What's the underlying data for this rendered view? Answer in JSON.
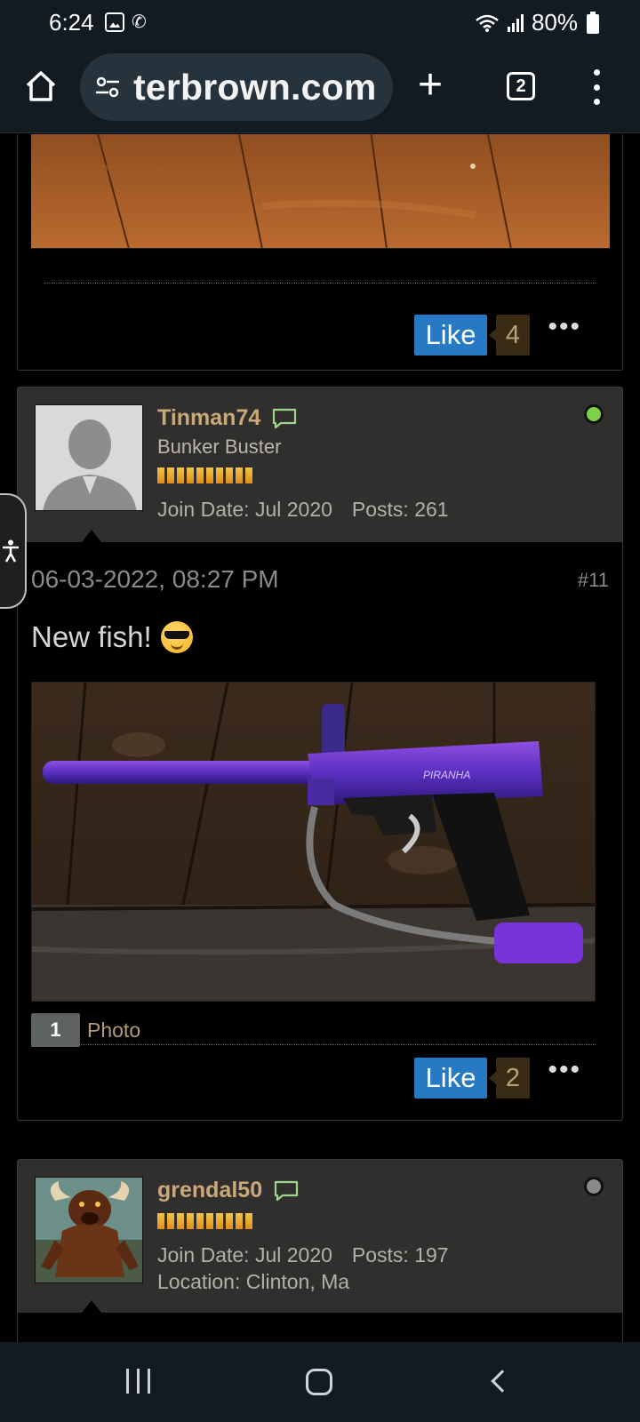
{
  "status_bar": {
    "time": "6:24",
    "battery": "80%"
  },
  "browser": {
    "url": "terbrown.com",
    "tab_count": "2"
  },
  "posts": [
    {
      "like_label": "Like",
      "like_count": "4",
      "more": "•••"
    },
    {
      "username": "Tinman74",
      "title": "Bunker Buster",
      "join_date": "Join Date: Jul 2020",
      "posts": "Posts: 261",
      "online_status_color": "#7fd14a",
      "date": "06-03-2022, 08:27 PM",
      "post_number": "#11",
      "text": "New fish!",
      "photo_count": "1",
      "photo_label": "Photo",
      "like_label": "Like",
      "like_count": "2",
      "more": "•••"
    },
    {
      "username": "grendal50",
      "join_date": "Join Date: Jul 2020",
      "posts": "Posts: 197",
      "location": "Location: Clinton, Ma",
      "online_status_color": "#8a8a8a"
    }
  ],
  "colors": {
    "accent_like": "#2779c4",
    "username": "#c9a97a",
    "header_bg": "#312f2d"
  },
  "icons": {
    "home": "home-icon",
    "site_settings": "tune-icon",
    "new_tab": "plus-icon",
    "tabs": "tab-switcher-icon",
    "menu": "more-vert-icon",
    "chat": "speech-bubble-icon",
    "accessibility": "accessibility-icon"
  }
}
